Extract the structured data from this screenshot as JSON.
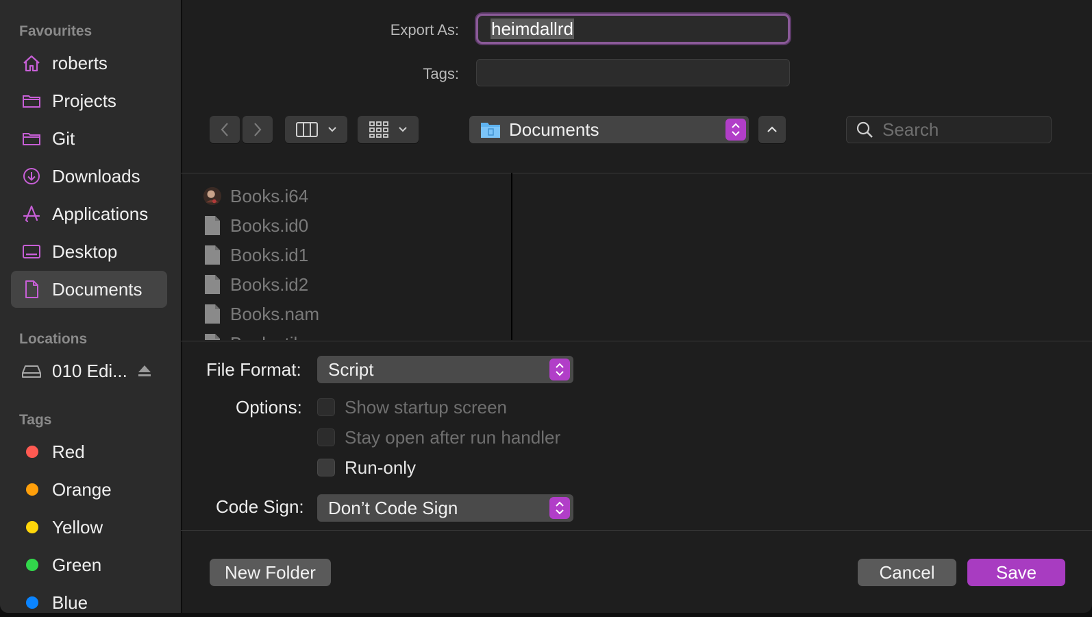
{
  "sidebar": {
    "favourites_heading": "Favourites",
    "favourites": [
      {
        "label": "roberts",
        "icon": "home-icon"
      },
      {
        "label": "Projects",
        "icon": "folder-icon"
      },
      {
        "label": "Git",
        "icon": "folder-icon"
      },
      {
        "label": "Downloads",
        "icon": "download-icon"
      },
      {
        "label": "Applications",
        "icon": "applications-icon"
      },
      {
        "label": "Desktop",
        "icon": "desktop-icon"
      },
      {
        "label": "Documents",
        "icon": "document-icon",
        "selected": true
      }
    ],
    "locations_heading": "Locations",
    "locations": [
      {
        "label": "010 Edi...",
        "icon": "drive-icon",
        "eject": true
      }
    ],
    "tags_heading": "Tags",
    "tags": [
      {
        "label": "Red",
        "color": "#ff5a52"
      },
      {
        "label": "Orange",
        "color": "#ff9f0a"
      },
      {
        "label": "Yellow",
        "color": "#ffd60a"
      },
      {
        "label": "Green",
        "color": "#32d74b"
      },
      {
        "label": "Blue",
        "color": "#0a84ff"
      }
    ]
  },
  "export": {
    "export_as_label": "Export As:",
    "export_as_value": "heimdallrd",
    "tags_label": "Tags:",
    "tags_value": ""
  },
  "toolbar": {
    "location": "Documents",
    "search_placeholder": "Search"
  },
  "files": [
    {
      "name": "Books.i64",
      "icon": "thumbnail-icon"
    },
    {
      "name": "Books.id0",
      "icon": "file-icon"
    },
    {
      "name": "Books.id1",
      "icon": "file-icon"
    },
    {
      "name": "Books.id2",
      "icon": "file-icon"
    },
    {
      "name": "Books.nam",
      "icon": "file-icon"
    },
    {
      "name": "Books.til",
      "icon": "file-icon"
    }
  ],
  "form": {
    "file_format_label": "File Format:",
    "file_format_value": "Script",
    "options_label": "Options:",
    "options": [
      {
        "label": "Show startup screen",
        "checked": false,
        "enabled": false
      },
      {
        "label": "Stay open after run handler",
        "checked": false,
        "enabled": false
      },
      {
        "label": "Run-only",
        "checked": false,
        "enabled": true
      }
    ],
    "code_sign_label": "Code Sign:",
    "code_sign_value": "Don’t Code Sign"
  },
  "buttons": {
    "new_folder": "New Folder",
    "cancel": "Cancel",
    "save": "Save"
  },
  "colors": {
    "accent": "#a83cc1",
    "sidebar_icon": "#c75fd6"
  }
}
